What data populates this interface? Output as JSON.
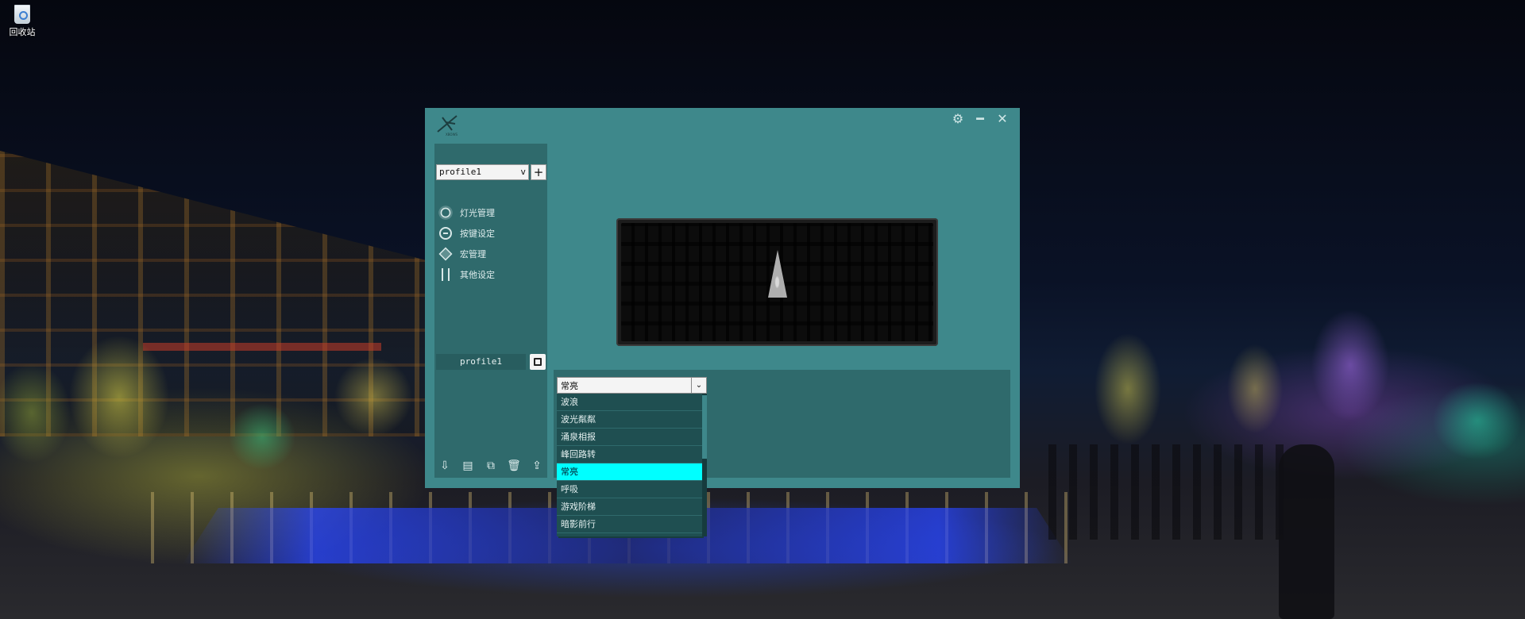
{
  "desktop": {
    "recycle_bin_label": "回收站"
  },
  "window": {
    "logo_text": "XBOWS",
    "title_buttons": [
      "gear-icon",
      "minimize-icon",
      "close-icon"
    ]
  },
  "sidebar": {
    "profile_select_value": "profile1",
    "profile_select_arrow": "v",
    "add_button_label": "+",
    "nav": [
      {
        "icon": "light-icon",
        "label": "灯光管理"
      },
      {
        "icon": "key-icon",
        "label": "按键设定"
      },
      {
        "icon": "macro-icon",
        "label": "宏管理"
      },
      {
        "icon": "settings-icon",
        "label": "其他设定"
      }
    ],
    "profile_name": "profile1",
    "bottom_tools": [
      "import-icon",
      "export-icon",
      "copy-icon",
      "delete-icon",
      "save-icon"
    ]
  },
  "lighting": {
    "selected_mode": "常亮",
    "mode_options": [
      "波浪",
      "波光粼粼",
      "涌泉相报",
      "峰回路转",
      "常亮",
      "呼吸",
      "游戏阶梯",
      "暗影前行"
    ],
    "active_option_index": 4
  },
  "colors": {
    "window_bg": "#3e888b",
    "panel_bg": "#2f6a6c",
    "highlight": "#00ffff"
  }
}
